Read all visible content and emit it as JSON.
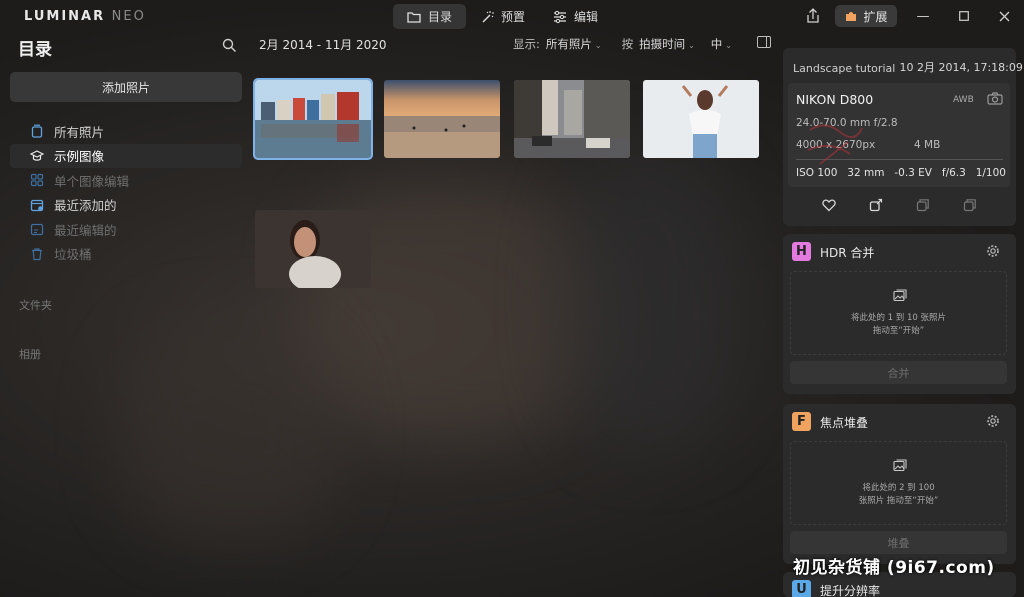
{
  "app": {
    "logo_main": "LUMINAR ",
    "logo_neo": "NEO"
  },
  "modes": [
    {
      "label": "目录",
      "icon": "folder-icon",
      "active": true
    },
    {
      "label": "预置",
      "icon": "magic-wand-icon",
      "active": false
    },
    {
      "label": "编辑",
      "icon": "sliders-icon",
      "active": false
    }
  ],
  "titlebar": {
    "extensions_label": "扩展"
  },
  "sidebar": {
    "title": "目录",
    "add_photos": "添加照片",
    "items": [
      {
        "label": "所有照片",
        "icon": "photos-icon",
        "state": "normal"
      },
      {
        "label": "示例图像",
        "icon": "graduation-cap-icon",
        "state": "active"
      },
      {
        "label": "单个图像编辑",
        "icon": "grid-icon",
        "state": "dim"
      },
      {
        "label": "最近添加的",
        "icon": "calendar-add-icon",
        "state": "normal"
      },
      {
        "label": "最近编辑的",
        "icon": "calendar-edit-icon",
        "state": "dim"
      },
      {
        "label": "垃圾桶",
        "icon": "trash-icon",
        "state": "dim"
      }
    ],
    "folders_label": "文件夹",
    "albums_label": "相册"
  },
  "toolbar": {
    "date_range": "2月 2014 - 11月 2020",
    "show_label": "显示:",
    "show_value": "所有照片",
    "sort_label": "按",
    "sort_value": "拍摄时间",
    "size_value": "中"
  },
  "info": {
    "filename": "Landscape tutorial",
    "date": "10 2月 2014, 17:18:09",
    "camera": "NIKON D800",
    "wb": "AWB",
    "lens": "24.0-70.0 mm f/2.8",
    "dimensions": "4000 x 2670px",
    "filesize": "4 MB",
    "iso": "ISO 100",
    "focal": "32 mm",
    "ev": "-0.3 EV",
    "aperture": "f/6.3",
    "shutter": "1/100"
  },
  "hdr": {
    "name": "HDR 合并",
    "icon_letter": "H",
    "icon_color": "#e27ae0",
    "drop_line1": "将此处的 1 到 10 张照片",
    "drop_line2": "拖动至“开始”",
    "button": "合并"
  },
  "focus": {
    "name": "焦点堆叠",
    "icon_letter": "F",
    "icon_color": "#f0a35e",
    "drop_line1": "将此处的 2 到 100",
    "drop_line2": "张照片 拖动至“开始”",
    "button": "堆叠"
  },
  "upscale": {
    "name": "提升分辨率",
    "icon_letter": "U",
    "icon_color": "#5aa8e8"
  },
  "watermark": "初见杂货铺 (9i67.com)"
}
